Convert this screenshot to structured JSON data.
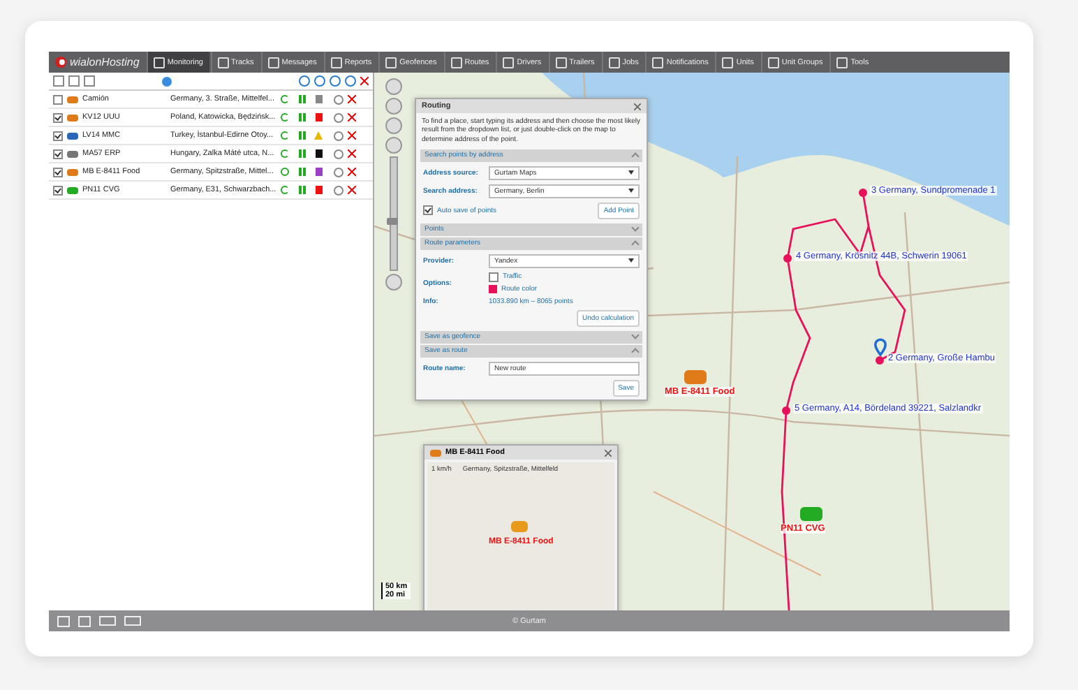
{
  "nav": {
    "logo": "wialonHosting",
    "items": [
      {
        "label": "Monitoring",
        "selected": true
      },
      {
        "label": "Tracks",
        "selected": false
      },
      {
        "label": "Messages",
        "selected": false
      },
      {
        "label": "Reports",
        "selected": false
      },
      {
        "label": "Geofences",
        "selected": false
      },
      {
        "label": "Routes",
        "selected": false
      },
      {
        "label": "Drivers",
        "selected": false
      },
      {
        "label": "Trailers",
        "selected": false
      },
      {
        "label": "Jobs",
        "selected": false
      },
      {
        "label": "Notifications",
        "selected": false
      },
      {
        "label": "Units",
        "selected": false
      },
      {
        "label": "Unit Groups",
        "selected": false
      },
      {
        "label": "Tools",
        "selected": false
      }
    ]
  },
  "units": {
    "rows": [
      {
        "name": "Camión",
        "address": "Germany, 3. Straße, Mittelfel...",
        "checked": false,
        "color": "#e07b1a",
        "moving": false,
        "status": {
          "kind": "square",
          "color": "#888888"
        }
      },
      {
        "name": "KV12 UUU",
        "address": "Poland, Katowicka, Będzińsk...",
        "checked": true,
        "color": "#e07b1a",
        "moving": false,
        "status": {
          "kind": "square",
          "color": "#ee1111"
        }
      },
      {
        "name": "LV14 MMC",
        "address": "Turkey, İstanbul-Edirne Otoy...",
        "checked": true,
        "color": "#2a66b8",
        "moving": false,
        "status": {
          "kind": "triangle",
          "color": "#e6b800"
        }
      },
      {
        "name": "MA57 ERP",
        "address": "Hungary, Zalka Máté utca, N...",
        "checked": true,
        "color": "#777777",
        "moving": false,
        "status": {
          "kind": "square",
          "color": "#111111"
        }
      },
      {
        "name": "MB E-8411 Food",
        "address": "Germany, Spitzstraße, Mittel...",
        "checked": true,
        "color": "#e07b1a",
        "moving": true,
        "status": {
          "kind": "square",
          "color": "#9b3fc4"
        }
      },
      {
        "name": "PN11 CVG",
        "address": "Germany, E31, Schwarzbach...",
        "checked": true,
        "color": "#22aa22",
        "moving": false,
        "status": {
          "kind": "square",
          "color": "#ee1111"
        }
      }
    ]
  },
  "routing": {
    "title": "Routing",
    "hint": "To find a place, start typing its address and then choose the most likely result from the dropdown list, or just double-click on the map to determine address of the point.",
    "sections": [
      {
        "kind": "search",
        "title": "Search points by address",
        "expanded": true,
        "fields": [
          {
            "label": "Address source:",
            "value": "Gurtam Maps"
          },
          {
            "label": "Search address:",
            "value": "Germany, Berlin"
          }
        ],
        "autosave": {
          "label": "Auto save of points",
          "checked": true
        },
        "button": "Add Point"
      },
      {
        "title": "Points",
        "expanded": false
      },
      {
        "kind": "params",
        "title": "Route parameters",
        "expanded": true,
        "provider_label": "Provider:",
        "provider": "Yandex",
        "options_label": "Options:",
        "traffic": {
          "label": "Traffic",
          "checked": false
        },
        "route_color": {
          "label": "Route color",
          "color": "#e8105a"
        },
        "info_label": "Info:",
        "info": "1033.890 km – 8065 points",
        "button": "Undo calculation"
      },
      {
        "title": "Save as geofence",
        "expanded": false
      },
      {
        "kind": "route",
        "title": "Save as route",
        "expanded": true,
        "name_label": "Route name:",
        "name": "New route",
        "button": "Save"
      }
    ]
  },
  "map": {
    "zoom": {
      "level": 0.45
    },
    "route_points": [
      {
        "label": "3 Germany, Sundpromenade 1"
      },
      {
        "label": "4 Germany, Krösnitz 44B, Schwerin 19061"
      },
      {
        "label": "2 Germany, Große Hambu"
      },
      {
        "label": "5 Germany, A14, Bördeland 39221, Salzlandkr"
      }
    ],
    "units": [
      {
        "label": "MB E-8411 Food",
        "color": "#e07b1a"
      },
      {
        "label": "PN11 CVG",
        "color": "#22aa22"
      }
    ],
    "scale": {
      "km": "50 km",
      "mi": "20 mi"
    }
  },
  "popup": {
    "title": "MB E-8411 Food",
    "speed": "1 km/h",
    "address": "Germany, Spitzstraße, Mittelfeld",
    "unit_label": "MB E-8411 Food"
  },
  "footer": {
    "copyright": "© Gurtam"
  }
}
